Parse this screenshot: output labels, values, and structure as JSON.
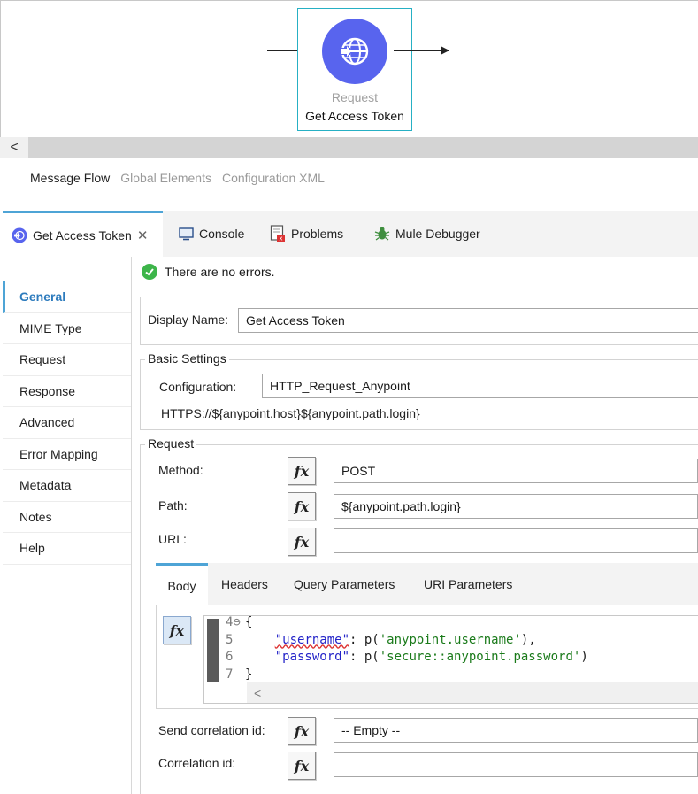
{
  "canvas": {
    "node": {
      "type_label": "Request",
      "name": "Get Access Token",
      "icon": "globe-icon",
      "color": "#5864ee"
    }
  },
  "scrollbar": {
    "left_arrow": "<"
  },
  "editor_tabs": [
    "Message Flow",
    "Global Elements",
    "Configuration XML"
  ],
  "view_tabs": {
    "active": {
      "label": "Get Access Token",
      "icon": "http-request-icon"
    },
    "others": [
      {
        "label": "Console",
        "icon": "console-icon"
      },
      {
        "label": "Problems",
        "icon": "problems-icon"
      },
      {
        "label": "Mule Debugger",
        "icon": "debugger-bug-icon"
      }
    ]
  },
  "nav": {
    "items": [
      "General",
      "MIME Type",
      "Request",
      "Response",
      "Advanced",
      "Error Mapping",
      "Metadata",
      "Notes",
      "Help"
    ],
    "active_index": 0
  },
  "status": {
    "message": "There are no errors."
  },
  "general": {
    "display_name_label": "Display Name:",
    "display_name_value": "Get Access Token"
  },
  "basic_settings": {
    "title": "Basic Settings",
    "configuration_label": "Configuration:",
    "configuration_value": "HTTP_Request_Anypoint",
    "url_preview": "HTTPS://${anypoint.host}${anypoint.path.login}"
  },
  "request": {
    "title": "Request",
    "method_label": "Method:",
    "method_value": "POST",
    "path_label": "Path:",
    "path_value": "${anypoint.path.login}",
    "url_label": "URL:",
    "url_value": "",
    "fx_label": "fx",
    "subtabs": [
      "Body",
      "Headers",
      "Query Parameters",
      "URI Parameters"
    ],
    "body_lines": [
      {
        "num": "4⊖",
        "text": "{"
      },
      {
        "num": "5",
        "key": "\"username\"",
        "mid": ": p(",
        "str": "'anypoint.username'",
        "end": "),"
      },
      {
        "num": "6",
        "key": "\"password\"",
        "mid": ": p(",
        "str": "'secure::anypoint.password'",
        "end": ")"
      },
      {
        "num": "7",
        "text": "}"
      }
    ],
    "send_correlation_label": "Send correlation id:",
    "send_correlation_value": "-- Empty --",
    "correlation_label": "Correlation id:",
    "correlation_value": ""
  },
  "colors": {
    "accent": "#4ea4d6",
    "node_border": "#26b0c4",
    "success": "#3db54a"
  }
}
